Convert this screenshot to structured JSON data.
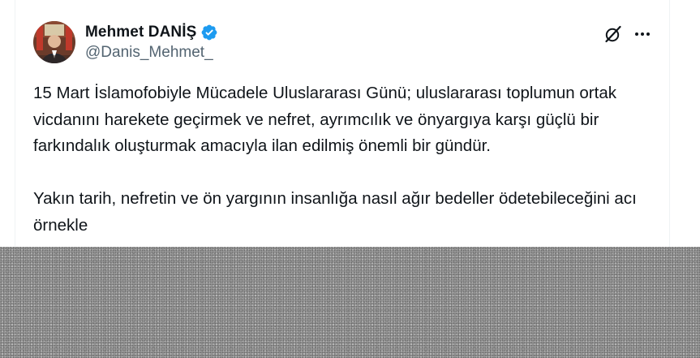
{
  "tweet": {
    "author": {
      "display_name": "Mehmet DANİŞ",
      "handle": "@Danis_Mehmet_",
      "verified": true,
      "avatar_icon": "avatar-photo"
    },
    "actions": {
      "grok_icon": "grok-icon",
      "more_icon": "more-options-icon"
    },
    "text": {
      "paragraph_1": "15 Mart İslamofobiyle Mücadele Uluslararası Günü; uluslararası toplumun ortak vicdanını harekete geçirmek ve nefret, ayrımcılık ve önyargıya karşı güçlü bir farkındalık oluşturmak amacıyla ilan edilmiş önemli bir gündür.",
      "paragraph_2": "Yakın tarih, nefretin ve ön yargının insanlığa nasıl ağır bedeller ödetebileceğini acı örnekle"
    }
  },
  "colors": {
    "text_primary": "#0f1419",
    "text_secondary": "#536471",
    "verified_blue": "#1d9bf0",
    "border": "#eff3f4"
  }
}
